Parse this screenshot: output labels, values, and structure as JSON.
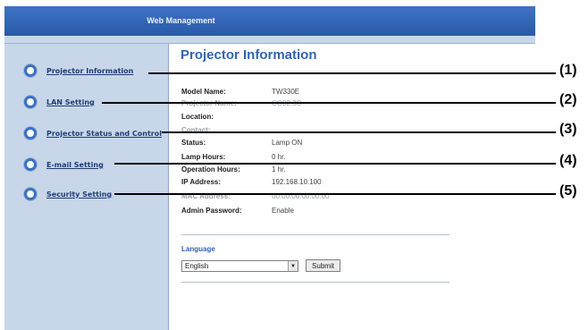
{
  "header": {
    "title": "Web Management"
  },
  "sidebar": {
    "items": [
      {
        "label": "Projector Information",
        "icon": "radio-bullet-icon"
      },
      {
        "label": "LAN Setting",
        "icon": "radio-bullet-icon"
      },
      {
        "label": "Projector Status and Control",
        "icon": "radio-bullet-icon"
      },
      {
        "label": "E-mail Setting",
        "icon": "radio-bullet-icon"
      },
      {
        "label": "Security Setting",
        "icon": "radio-bullet-icon"
      }
    ]
  },
  "main": {
    "title": "Projector Information",
    "info": [
      {
        "label": "Model Name:",
        "value": "TW330E"
      },
      {
        "label": "Projector Name:",
        "value": "CG02.3C"
      },
      {
        "label": "Location:",
        "value": ""
      },
      {
        "label": "Contact:",
        "value": ""
      },
      {
        "label": "Status:",
        "value": "Lamp ON"
      },
      {
        "label": "Lamp Hours:",
        "value": "0 hr."
      },
      {
        "label": "Operation Hours:",
        "value": "1 hr."
      },
      {
        "label": "IP Address:",
        "value": "192.168.10.100"
      },
      {
        "label": "MAC Address:",
        "value": "00:00:00:00:00:00"
      },
      {
        "label": "Admin Password:",
        "value": "Enable"
      }
    ],
    "language": {
      "label": "Language",
      "selected": "English",
      "submit_label": "Submit"
    }
  },
  "callouts": [
    "(1)",
    "(2)",
    "(3)",
    "(4)",
    "(5)"
  ],
  "colors": {
    "header": "#2f63b4",
    "sidebar": "#c8d6e9",
    "title": "#3165b3",
    "bullet": "#3c72c2"
  }
}
